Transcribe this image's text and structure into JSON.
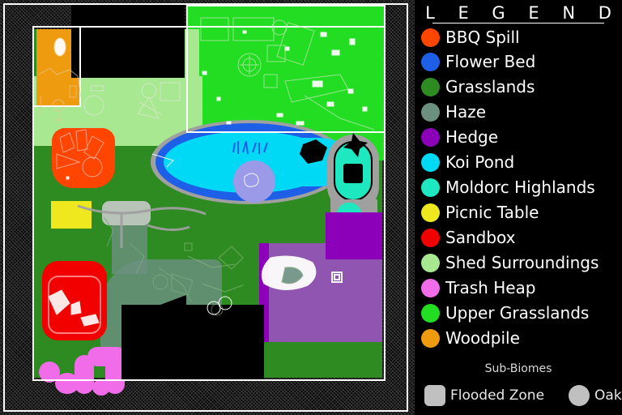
{
  "legend": {
    "title": "L E G E N D",
    "items": [
      {
        "label": "BBQ Spill",
        "color": "#FF4500"
      },
      {
        "label": "Flower Bed",
        "color": "#1E5FE8"
      },
      {
        "label": "Grasslands",
        "color": "#2E8B22"
      },
      {
        "label": "Haze",
        "color": "#6B9080"
      },
      {
        "label": "Hedge",
        "color": "#8B00B8"
      },
      {
        "label": "Koi Pond",
        "color": "#00D9F5"
      },
      {
        "label": "Moldorc Highlands",
        "color": "#1EE8C0"
      },
      {
        "label": "Picnic Table",
        "color": "#EFE81E"
      },
      {
        "label": "Sandbox",
        "color": "#F20000"
      },
      {
        "label": "Shed Surroundings",
        "color": "#A8E890"
      },
      {
        "label": "Trash Heap",
        "color": "#F06CE8"
      },
      {
        "label": "Upper Grasslands",
        "color": "#22DD22"
      },
      {
        "label": "Woodpile",
        "color": "#EF9B10"
      }
    ],
    "sub_biomes": {
      "title": "Sub-Biomes",
      "items": [
        {
          "label": "Flooded Zone",
          "shape": "square",
          "color": "#C0C0C0"
        },
        {
          "label": "Oak Hill",
          "shape": "circle",
          "color": "#C0C0C0"
        }
      ]
    }
  },
  "map": {
    "background": "#000000",
    "out_of_bounds_pattern": "diagonal-hatch",
    "regions": [
      {
        "name": "upper-grasslands",
        "color": "#22DD22"
      },
      {
        "name": "shed-surroundings",
        "color": "#A8E890"
      },
      {
        "name": "woodpile",
        "color": "#EF9B10"
      },
      {
        "name": "grasslands",
        "color": "#2E8B22"
      },
      {
        "name": "haze",
        "color": "#6B9080"
      },
      {
        "name": "koi-pond",
        "color": "#00D9F5"
      },
      {
        "name": "flower-bed",
        "color": "#1E5FE8"
      },
      {
        "name": "moldorc-highlands",
        "color": "#1EE8C0"
      },
      {
        "name": "hedge",
        "color": "#8B00B8"
      },
      {
        "name": "bbq-spill",
        "color": "#FF4500"
      },
      {
        "name": "sandbox",
        "color": "#F20000"
      },
      {
        "name": "picnic-table",
        "color": "#EFE81E"
      },
      {
        "name": "trash-heap",
        "color": "#F06CE8"
      },
      {
        "name": "oak-hill",
        "color": "#9A9AE8"
      },
      {
        "name": "flooded-zone",
        "color": "#B8C4B8"
      },
      {
        "name": "stone-border",
        "color": "#A0A0A0"
      }
    ]
  }
}
